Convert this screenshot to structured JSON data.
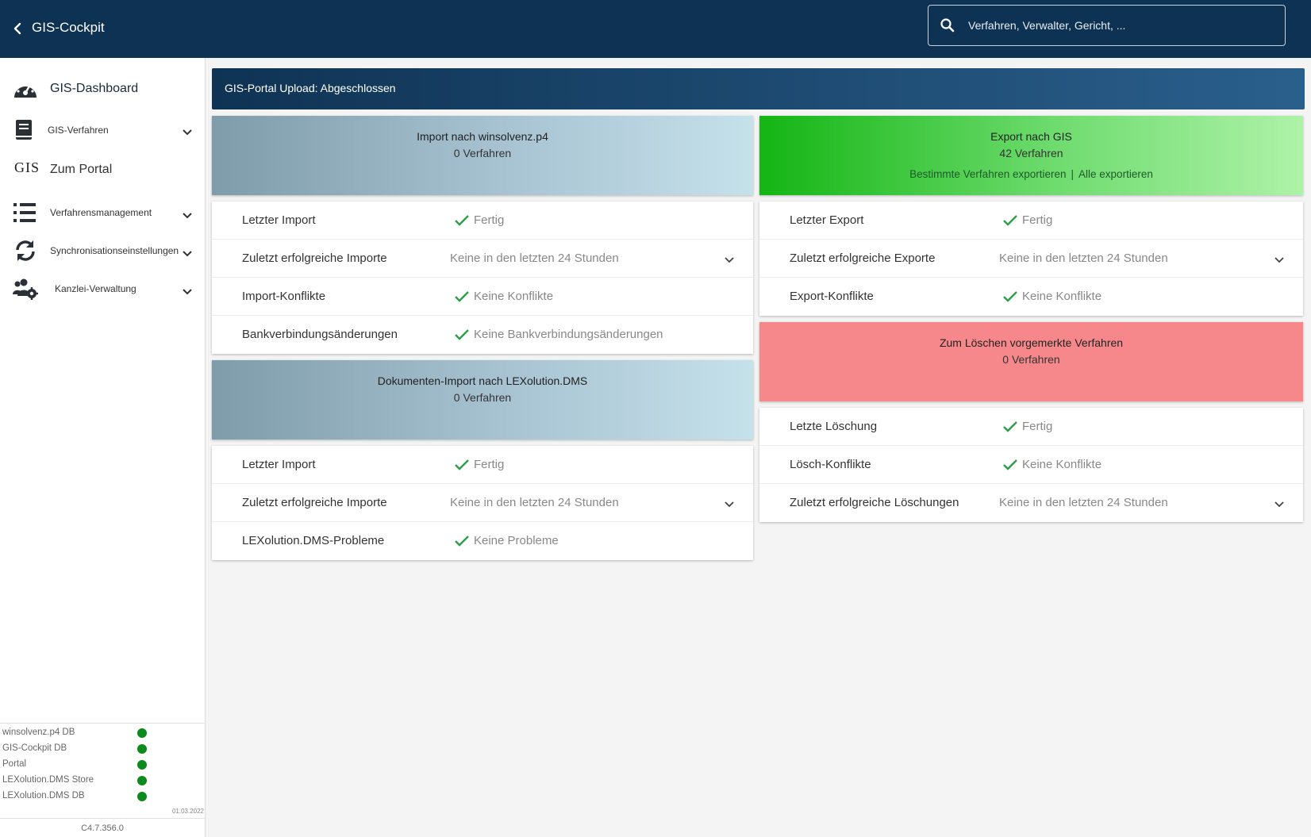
{
  "header": {
    "title": "GIS-Cockpit",
    "search_placeholder": "Verfahren, Verwalter, Gericht, ..."
  },
  "sidebar": {
    "dashboard": "GIS-Dashboard",
    "verfahren": "GIS-Verfahren",
    "portal_prefix": "GIS",
    "portal": "Zum Portal",
    "management": "Verfahrensmanagement",
    "sync": "Synchronisationseinstellungen",
    "kanzlei": "Kanzlei-Verwaltung",
    "status": [
      {
        "name": "winsolvenz.p4 DB",
        "state": "ok"
      },
      {
        "name": "GIS-Cockpit DB",
        "state": "ok"
      },
      {
        "name": "Portal",
        "state": "ok"
      },
      {
        "name": "LEXolution.DMS Store",
        "state": "ok"
      },
      {
        "name": "LEXolution.DMS DB",
        "state": "ok"
      }
    ],
    "date": "01.03.2022",
    "version": "C4.7.356.0"
  },
  "banner": "GIS-Portal Upload: Abgeschlossen",
  "import_card": {
    "title": "Import nach winsolvenz.p4",
    "count": "0 Verfahren",
    "rows": [
      {
        "label": "Letzter Import",
        "value": "Fertig"
      },
      {
        "label": "Zuletzt erfolgreiche Importe",
        "value": "Keine in den letzten 24 Stunden"
      },
      {
        "label": "Import-Konflikte",
        "value": "Keine Konflikte"
      },
      {
        "label": "Bankverbindungsänderungen",
        "value": "Keine Bankverbindungsänderungen"
      }
    ]
  },
  "dms_card": {
    "title": "Dokumenten-Import nach LEXolution.DMS",
    "count": "0 Verfahren",
    "rows": [
      {
        "label": "Letzter Import",
        "value": "Fertig"
      },
      {
        "label": "Zuletzt erfolgreiche Importe",
        "value": "Keine in den letzten 24 Stunden"
      },
      {
        "label": "LEXolution.DMS-Probleme",
        "value": "Keine Probleme"
      }
    ]
  },
  "export_card": {
    "title": "Export nach GIS",
    "count": "42 Verfahren",
    "link_selected": "Bestimmte Verfahren exportieren",
    "link_separator": "|",
    "link_all": "Alle exportieren",
    "rows": [
      {
        "label": "Letzter Export",
        "value": "Fertig"
      },
      {
        "label": "Zuletzt erfolgreiche Exporte",
        "value": "Keine in den letzten 24 Stunden"
      },
      {
        "label": "Export-Konflikte",
        "value": "Keine Konflikte"
      }
    ]
  },
  "delete_card": {
    "title": "Zum Löschen vorgemerkte Verfahren",
    "count": "0 Verfahren",
    "rows": [
      {
        "label": "Letzte Löschung",
        "value": "Fertig"
      },
      {
        "label": "Lösch-Konflikte",
        "value": "Keine Konflikte"
      },
      {
        "label": "Zuletzt erfolgreiche Löschungen",
        "value": "Keine in den letzten 24 Stunden"
      }
    ]
  },
  "colors": {
    "topbar": "#0d3254",
    "check": "#2e9e48",
    "status_ok": "#0c8a1c",
    "import_head": "#a8c3d2",
    "export_head": "#14b514",
    "delete_head": "#f6888b"
  }
}
